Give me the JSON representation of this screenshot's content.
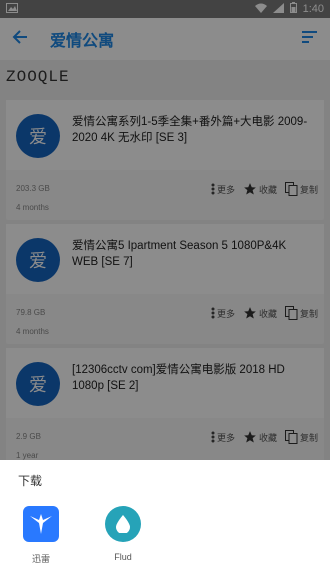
{
  "status_bar": {
    "time": "1:40"
  },
  "app_bar": {
    "title": "爱情公寓"
  },
  "site": {
    "brand": "ZOOQLE"
  },
  "results": [
    {
      "avatar_char": "爱",
      "title": "爱情公寓系列1-5季全集+番外篇+大电影 2009-2020 4K 无水印 [SE 3]",
      "size": "203.3 GB",
      "age": "4 months",
      "more_label": "更多",
      "favorite_label": "收藏",
      "copy_label": "复制"
    },
    {
      "avatar_char": "爱",
      "title": "爱情公寓5 Ipartment Season 5 1080P&4K WEB [SE 7]",
      "size": "79.8 GB",
      "age": "4 months",
      "more_label": "更多",
      "favorite_label": "收藏",
      "copy_label": "复制"
    },
    {
      "avatar_char": "爱",
      "title": "[12306cctv com]爱情公寓电影版 2018 HD 1080p [SE 2]",
      "size": "2.9 GB",
      "age": "1 year",
      "more_label": "更多",
      "favorite_label": "收藏",
      "copy_label": "复制"
    }
  ],
  "sheet": {
    "title": "下载",
    "apps": [
      {
        "label": "迅雷",
        "icon": "xunlei-bird-icon",
        "color": "#2979ff"
      },
      {
        "label": "Flud",
        "icon": "flud-drop-icon",
        "color": "#26a3b8"
      }
    ]
  },
  "colors": {
    "accent": "#1e88e5",
    "avatar": "#1565c0"
  }
}
